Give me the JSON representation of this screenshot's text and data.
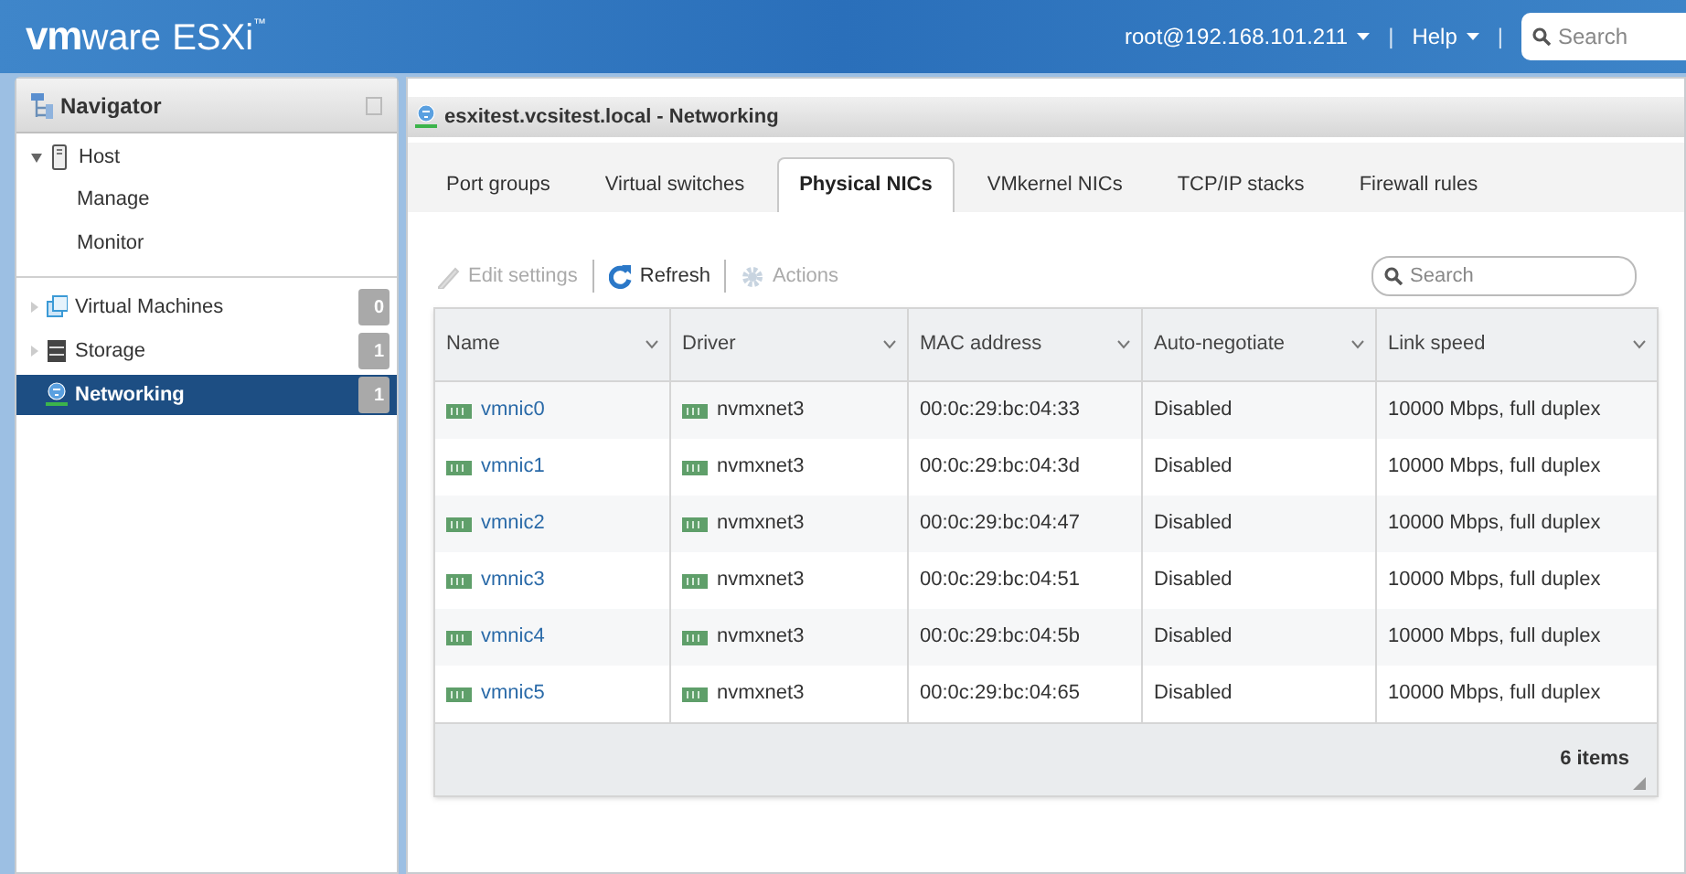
{
  "header": {
    "logo_mark": "vm",
    "logo_word": "ware",
    "product": "ESXi",
    "trademark": "™",
    "user": "root@192.168.101.211",
    "separator_1": "|",
    "help": "Help",
    "separator_2": "|",
    "search": {
      "placeholder": "Search"
    }
  },
  "navigator": {
    "title": "Navigator",
    "items": [
      {
        "label": "Host",
        "kind": "host",
        "expanded": true,
        "selected": false,
        "children": [
          {
            "label": "Manage",
            "selected": false
          },
          {
            "label": "Monitor",
            "selected": false
          }
        ]
      },
      {
        "label": "Virtual Machines",
        "kind": "vms",
        "expanded": false,
        "selected": false,
        "count": "0"
      },
      {
        "label": "Storage",
        "kind": "storage",
        "expanded": false,
        "selected": false,
        "count": "1"
      },
      {
        "label": "Networking",
        "kind": "network",
        "selected": true,
        "count": "1"
      }
    ]
  },
  "main": {
    "title": "esxitest.vcsitest.local - Networking",
    "tabs": [
      {
        "label": "Port groups",
        "selected": false
      },
      {
        "label": "Virtual switches",
        "selected": false
      },
      {
        "label": "Physical NICs",
        "selected": true
      },
      {
        "label": "VMkernel NICs",
        "selected": false
      },
      {
        "label": "TCP/IP stacks",
        "selected": false
      },
      {
        "label": "Firewall rules",
        "selected": false
      }
    ],
    "toolbar": [
      {
        "label": "Edit settings",
        "kind": "edit",
        "disabled": true
      },
      {
        "label": "Refresh",
        "kind": "refresh",
        "disabled": false
      },
      {
        "label": "Actions",
        "kind": "actions",
        "disabled": true
      }
    ],
    "search": {
      "placeholder": "Search"
    },
    "table": {
      "columns": [
        "Name",
        "Driver",
        "MAC address",
        "Auto-negotiate",
        "Link speed"
      ],
      "rows": [
        [
          "vmnic0",
          "nvmxnet3",
          "00:0c:29:bc:04:33",
          "Disabled",
          "10000 Mbps, full duplex"
        ],
        [
          "vmnic1",
          "nvmxnet3",
          "00:0c:29:bc:04:3d",
          "Disabled",
          "10000 Mbps, full duplex"
        ],
        [
          "vmnic2",
          "nvmxnet3",
          "00:0c:29:bc:04:47",
          "Disabled",
          "10000 Mbps, full duplex"
        ],
        [
          "vmnic3",
          "nvmxnet3",
          "00:0c:29:bc:04:51",
          "Disabled",
          "10000 Mbps, full duplex"
        ],
        [
          "vmnic4",
          "nvmxnet3",
          "00:0c:29:bc:04:5b",
          "Disabled",
          "10000 Mbps, full duplex"
        ],
        [
          "vmnic5",
          "nvmxnet3",
          "00:0c:29:bc:04:65",
          "Disabled",
          "10000 Mbps, full duplex"
        ]
      ],
      "footer": "6 items"
    }
  }
}
